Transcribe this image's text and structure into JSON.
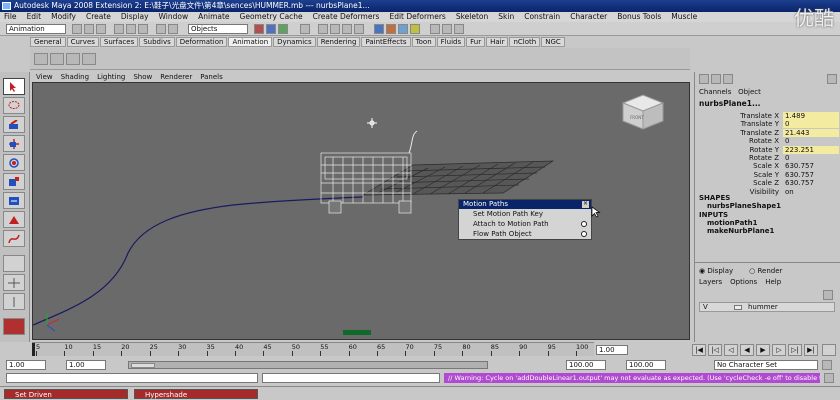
{
  "window": {
    "title": "Autodesk Maya 2008 Extension 2: E:\\鞋子\\光盘文件\\第4章\\sences\\HUMMER.mb   ---   nurbsPlane1...",
    "watermark": "优酷"
  },
  "menubar": [
    "File",
    "Edit",
    "Modify",
    "Create",
    "Display",
    "Window",
    "Animate",
    "Geometry Cache",
    "Create Deformers",
    "Edit Deformers",
    "Skeleton",
    "Skin",
    "Constrain",
    "Character",
    "Bonus Tools",
    "Muscle"
  ],
  "status_line": {
    "mode": "Animation",
    "objects_field": "Objects"
  },
  "shelf_tabs": [
    "General",
    "Curves",
    "Surfaces",
    "Subdivs",
    "Deformation",
    "Animation",
    "Dynamics",
    "Rendering",
    "PaintEffects",
    "Toon",
    "Fluids",
    "Fur",
    "Hair",
    "nCloth",
    "NGC"
  ],
  "shelf_active": "Animation",
  "viewport_menu": [
    "View",
    "Shading",
    "Lighting",
    "Show",
    "Renderer",
    "Panels"
  ],
  "viewcube_label": "FRONT",
  "context_menu": {
    "title": "Motion Paths",
    "items": [
      {
        "label": "Set Motion Path Key",
        "has_option": false
      },
      {
        "label": "Attach to Motion Path",
        "has_option": true
      },
      {
        "label": "Flow Path Object",
        "has_option": true
      }
    ]
  },
  "channel_box": {
    "tabs": [
      "Channels",
      "Object"
    ],
    "object_name": "nurbsPlane1...",
    "attributes": [
      {
        "name": "Translate X",
        "value": "1.489",
        "keyed": true
      },
      {
        "name": "Translate Y",
        "value": "0",
        "keyed": true
      },
      {
        "name": "Translate Z",
        "value": "21.443",
        "keyed": true
      },
      {
        "name": "Rotate X",
        "value": "0",
        "keyed": false
      },
      {
        "name": "Rotate Y",
        "value": "223.251",
        "keyed": true
      },
      {
        "name": "Rotate Z",
        "value": "0",
        "keyed": false
      },
      {
        "name": "Scale X",
        "value": "630.757",
        "keyed": false
      },
      {
        "name": "Scale Y",
        "value": "630.757",
        "keyed": false
      },
      {
        "name": "Scale Z",
        "value": "630.757",
        "keyed": false
      },
      {
        "name": "Visibility",
        "value": "on",
        "keyed": false
      }
    ],
    "shapes_label": "SHAPES",
    "shapes": [
      "nurbsPlaneShape1"
    ],
    "inputs_label": "INPUTS",
    "inputs": [
      "motionPath1",
      "makeNurbPlane1"
    ]
  },
  "layer_editor": {
    "tabs": [
      "Display",
      "Render"
    ],
    "menu": [
      "Layers",
      "Options",
      "Help"
    ],
    "layer_name": "hummer",
    "layer_flag": "V"
  },
  "time_slider": {
    "ticks": [
      "5",
      "10",
      "15",
      "20",
      "25",
      "30",
      "35",
      "40",
      "45",
      "50",
      "55",
      "60",
      "65",
      "70",
      "75",
      "80",
      "85",
      "90",
      "95",
      "100"
    ],
    "current_frame": "1.00"
  },
  "range_slider": {
    "start": "1.00",
    "playback_start": "1.00",
    "playback_end": "100.00",
    "end": "100.00",
    "character_set": "No Character Set"
  },
  "command_line": {
    "warning": "// Warning: Cycle on 'addDoubleLinear1.output' may not evaluate as expected.  (Use 'cycleCheck -e off' to disable this warning.) //"
  },
  "taskbar": {
    "items": [
      "Set Driven",
      "Hypershade"
    ]
  }
}
